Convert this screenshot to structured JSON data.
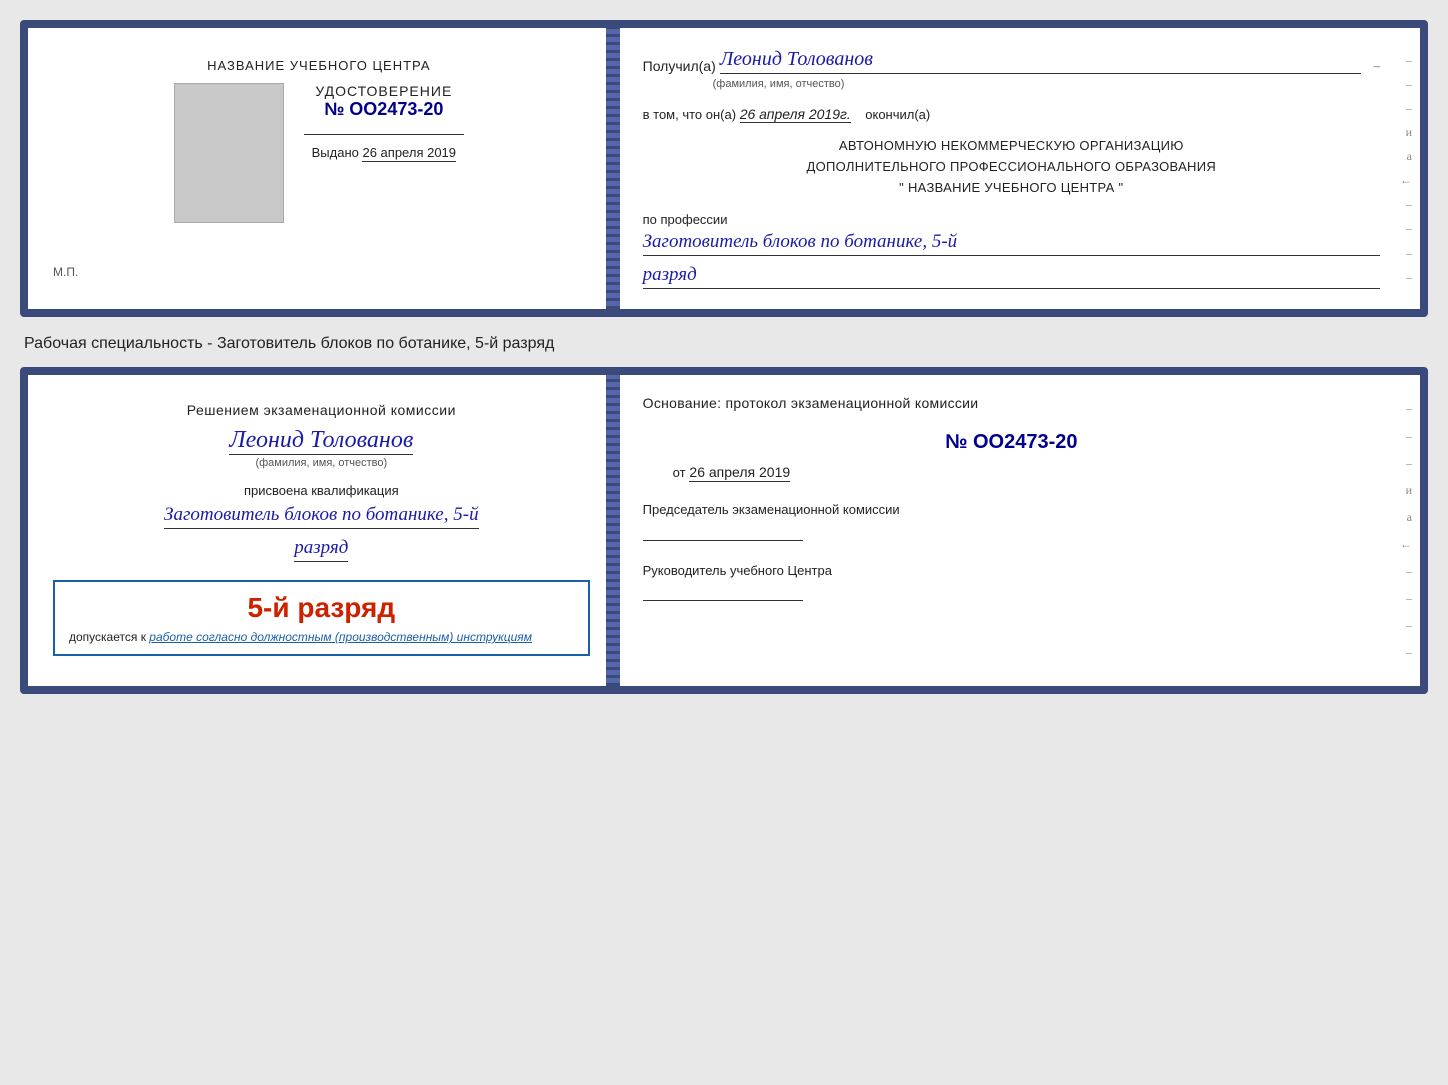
{
  "card1": {
    "left": {
      "training_center": "НАЗВАНИЕ УЧЕБНОГО ЦЕНТРА",
      "certificate_title": "УДОСТОВЕРЕНИЕ",
      "certificate_number": "№ OO2473-20",
      "issued_label": "Выдано",
      "issued_date": "26 апреля 2019",
      "stamp_label": "М.П."
    },
    "right": {
      "recipient_prefix": "Получил(а)",
      "recipient_name": "Леонид Толованов",
      "recipient_sublabel": "(фамилия, имя, отчество)",
      "confirm_text": "в том, что он(а)",
      "confirm_date": "26 апреля 2019г.",
      "confirm_suffix": "окончил(а)",
      "org_line1": "АВТОНОМНУЮ НЕКОММЕРЧЕСКУЮ ОРГАНИЗАЦИЮ",
      "org_line2": "ДОПОЛНИТЕЛЬНОГО ПРОФЕССИОНАЛЬНОГО ОБРАЗОВАНИЯ",
      "org_line3": "\"  НАЗВАНИЕ УЧЕБНОГО ЦЕНТРА  \"",
      "profession_label": "по профессии",
      "profession_value": "Заготовитель блоков по ботанике, 5-й",
      "rank_value": "разряд"
    }
  },
  "caption": "Рабочая специальность - Заготовитель блоков по ботанике, 5-й разряд",
  "card2": {
    "left": {
      "decision_line1": "Решением экзаменационной комиссии",
      "person_name": "Леонид Толованов",
      "person_sublabel": "(фамилия, имя, отчество)",
      "assigned_text": "присвоена квалификация",
      "qualification_value": "Заготовитель блоков по ботанике, 5-й",
      "rank_value": "разряд",
      "stamp_rank": "5-й разряд",
      "stamp_allowed": "допускается к",
      "stamp_italic": "работе согласно должностным (производственным) инструкциям"
    },
    "right": {
      "basis_title": "Основание: протокол экзаменационной комиссии",
      "protocol_number": "№  OO2473-20",
      "from_label": "от",
      "from_date": "26 апреля 2019",
      "chairman_title": "Председатель экзаменационной комиссии",
      "director_title": "Руководитель учебного Центра"
    }
  },
  "side_marks": [
    "-",
    "-",
    "-",
    "и",
    "а",
    "←",
    "-",
    "-",
    "-",
    "-"
  ]
}
